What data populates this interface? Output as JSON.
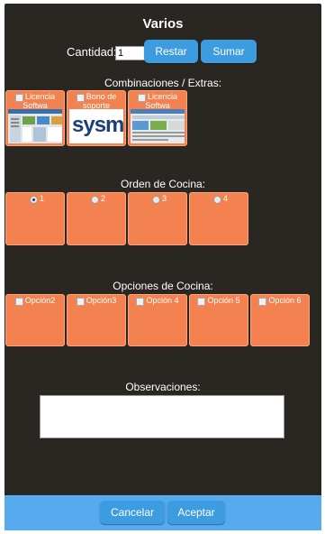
{
  "dialog": {
    "title": "Varios",
    "quantity": {
      "label": "Cantidad:",
      "value": "1"
    },
    "restar_label": "Restar",
    "sumar_label": "Sumar"
  },
  "combinaciones": {
    "label": "Combinaciones / Extras:",
    "items": [
      {
        "label_line1": "Licencia",
        "label_line2": "Softwa",
        "checked": false
      },
      {
        "label_line1": "Bono de",
        "label_line2": "soporte",
        "logo_text": "sysme",
        "checked": false
      },
      {
        "label_line1": "Licencia",
        "label_line2": "Softwa",
        "checked": false
      }
    ]
  },
  "orden": {
    "label": "Orden de Cocina:",
    "items": [
      {
        "label": "1",
        "selected": true
      },
      {
        "label": "2",
        "selected": false
      },
      {
        "label": "3",
        "selected": false
      },
      {
        "label": "4",
        "selected": false
      }
    ]
  },
  "opciones": {
    "label": "Opciones de Cocina:",
    "items": [
      {
        "label": "Opción2",
        "checked": false
      },
      {
        "label": "Opción3",
        "checked": false
      },
      {
        "label": "Opción 4",
        "checked": false
      },
      {
        "label": "Opción 5",
        "checked": false
      },
      {
        "label": "Opción 6",
        "checked": false
      }
    ]
  },
  "observaciones": {
    "label": "Observaciones:",
    "value": ""
  },
  "footer": {
    "cancel_label": "Cancelar",
    "accept_label": "Aceptar"
  },
  "colors": {
    "dialog_bg": "#2a2622",
    "tile": "#f48250",
    "button": "#3d9be0",
    "footer": "#57aaee"
  }
}
